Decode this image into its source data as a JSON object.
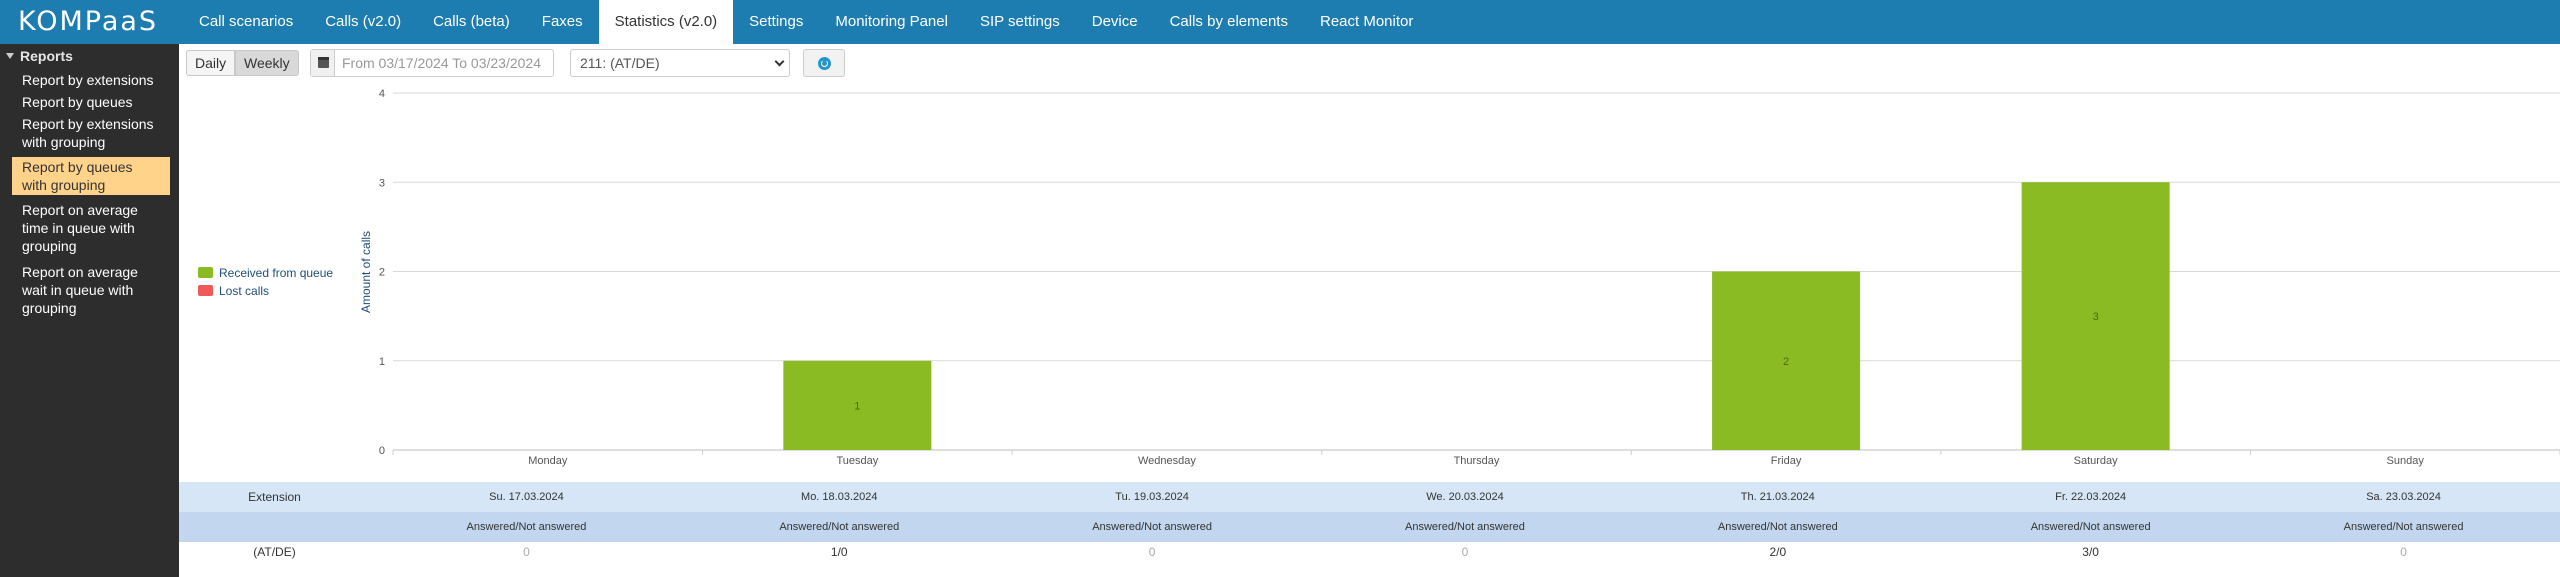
{
  "app": {
    "logo": "KOMPaaS"
  },
  "nav": {
    "tabs": [
      {
        "label": "Call scenarios"
      },
      {
        "label": "Calls (v2.0)"
      },
      {
        "label": "Calls (beta)"
      },
      {
        "label": "Faxes"
      },
      {
        "label": "Statistics (v2.0)"
      },
      {
        "label": "Settings"
      },
      {
        "label": "Monitoring Panel"
      },
      {
        "label": "SIP settings"
      },
      {
        "label": "Device"
      },
      {
        "label": "Calls by elements"
      },
      {
        "label": "React Monitor"
      }
    ],
    "active_index": 4
  },
  "sidebar": {
    "header": "Reports",
    "items": [
      {
        "label": "Report by extensions"
      },
      {
        "label": "Report by queues"
      },
      {
        "label": "Report by extensions with grouping"
      },
      {
        "label": "Report by queues with grouping"
      },
      {
        "label": "Report on average time in queue with grouping"
      },
      {
        "label": "Report on average wait in queue with grouping"
      }
    ],
    "active_index": 3
  },
  "toolbar": {
    "daily_label": "Daily",
    "weekly_label": "Weekly",
    "date_range": "From 03/17/2024 To 03/23/2024",
    "extension_selected": "211: (AT/DE)"
  },
  "chart_data": {
    "type": "bar",
    "categories": [
      "Monday",
      "Tuesday",
      "Wednesday",
      "Thursday",
      "Friday",
      "Saturday",
      "Sunday"
    ],
    "series": [
      {
        "name": "Received from queue",
        "color": "#8bbb22",
        "values": [
          0,
          1,
          0,
          0,
          2,
          3,
          0
        ]
      },
      {
        "name": "Lost calls",
        "color": "#f0585a",
        "values": [
          0,
          0,
          0,
          0,
          0,
          0,
          0
        ]
      }
    ],
    "ylabel": "Amount of calls",
    "ylim": [
      0,
      4
    ],
    "yticks": [
      0,
      1,
      2,
      3,
      4
    ],
    "grid": true,
    "legend_position": "left"
  },
  "table": {
    "ext_header": "Extension",
    "dates": [
      "Su. 17.03.2024",
      "Mo. 18.03.2024",
      "Tu. 19.03.2024",
      "We. 20.03.2024",
      "Th. 21.03.2024",
      "Fr. 22.03.2024",
      "Sa. 23.03.2024"
    ],
    "sub_header": "Answered/Not answered",
    "rows": [
      {
        "name": "(AT/DE)",
        "values": [
          "0",
          "1/0",
          "0",
          "0",
          "2/0",
          "3/0",
          "0"
        ]
      }
    ]
  }
}
